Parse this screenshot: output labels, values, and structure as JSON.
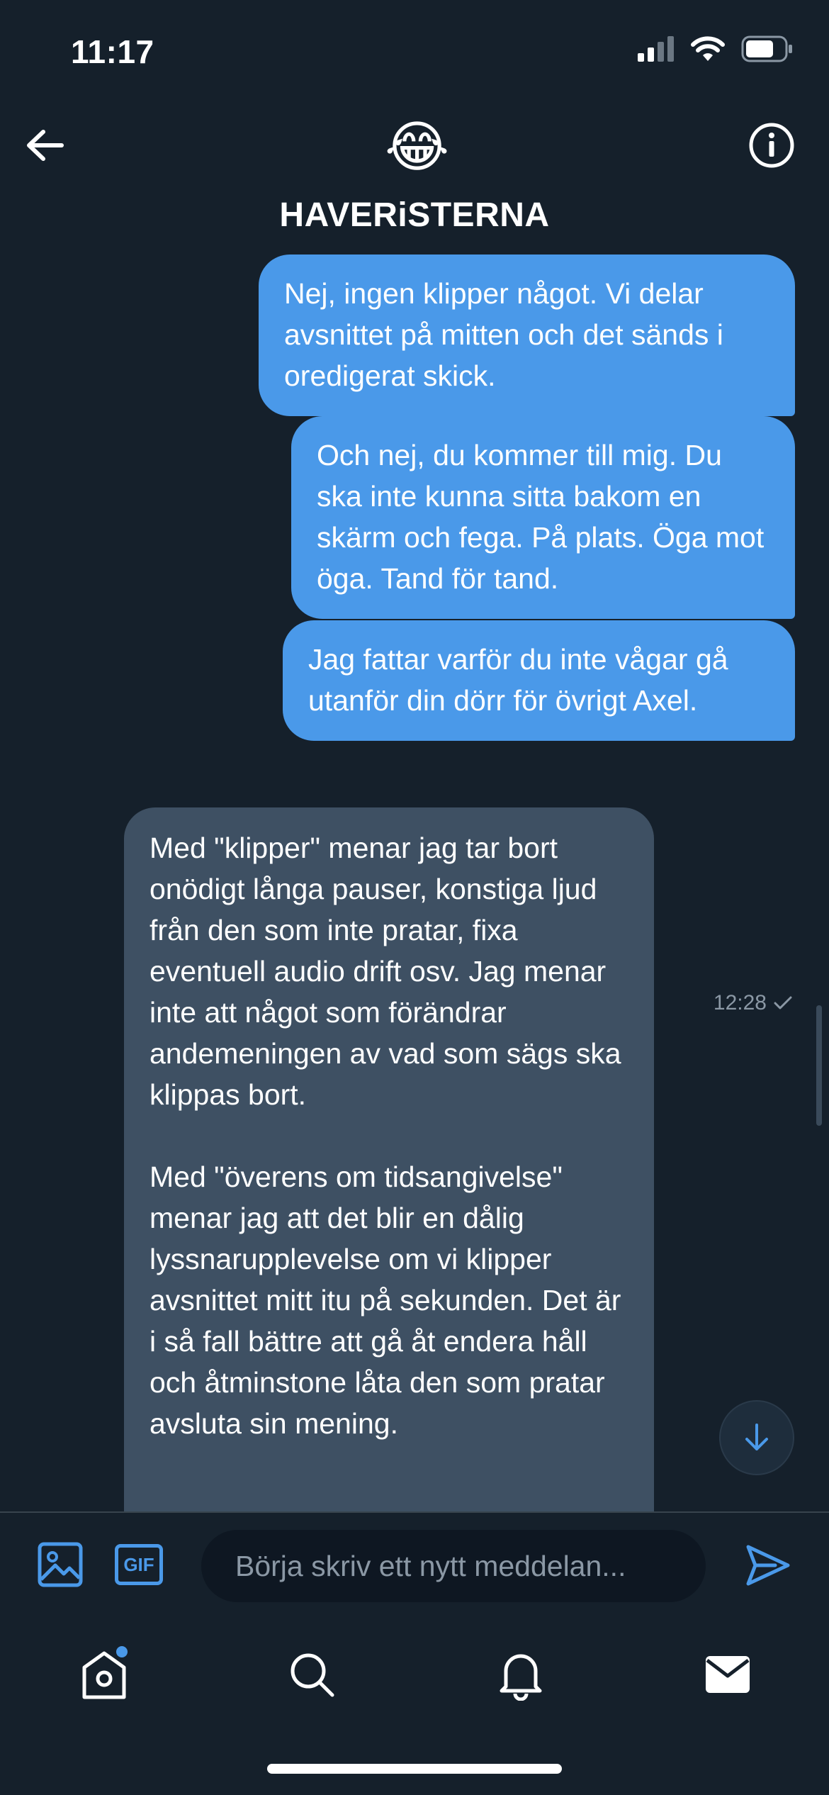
{
  "status_bar": {
    "time": "11:17",
    "icons": [
      "signal-icon",
      "wifi-icon",
      "battery-icon"
    ]
  },
  "header": {
    "avatar_emoji": "😂",
    "title": "HAVERiSTERNA",
    "back_icon": "arrow-left-icon",
    "info_icon": "info-icon"
  },
  "messages": {
    "outgoing": [
      {
        "text": "Nej, ingen klipper något. Vi delar avsnittet på mitten och det sänds i oredigerat skick."
      },
      {
        "text": "Och nej, du kommer till mig. Du ska inte kunna sitta bakom en skärm och fega. På plats. Öga mot öga. Tand för tand."
      },
      {
        "text": "Jag fattar varför du inte vågar gå utanför din dörr för övrigt Axel."
      }
    ],
    "outgoing_time": "12:28",
    "incoming": [
      {
        "text": "Med \"klipper\" menar jag tar bort onödigt långa pauser, konstiga ljud från den som inte pratar, fixa eventuell audio drift osv. Jag menar inte att något som förändrar andemeningen av vad som sägs ska klippas bort.\n\nMed \"överens om tidsangivelse\" menar jag att det blir en dålig lyssnarupplevelse om vi klipper avsnittet mitt itu på sekunden. Det är i så fall bättre att gå åt endera håll och åtminstone låta den som pratar avsluta sin mening."
      }
    ]
  },
  "composer": {
    "placeholder": "Börja skriv ett nytt meddelan...",
    "gif_label": "GIF"
  },
  "tabbar": {
    "items": [
      "home-icon",
      "search-icon",
      "notifications-icon",
      "messages-icon"
    ]
  },
  "colors": {
    "background": "#15202b",
    "outgoing_bubble": "#4a99e9",
    "incoming_bubble": "#3e5063",
    "accent": "#4a99e9",
    "muted_text": "#8b98a5"
  }
}
